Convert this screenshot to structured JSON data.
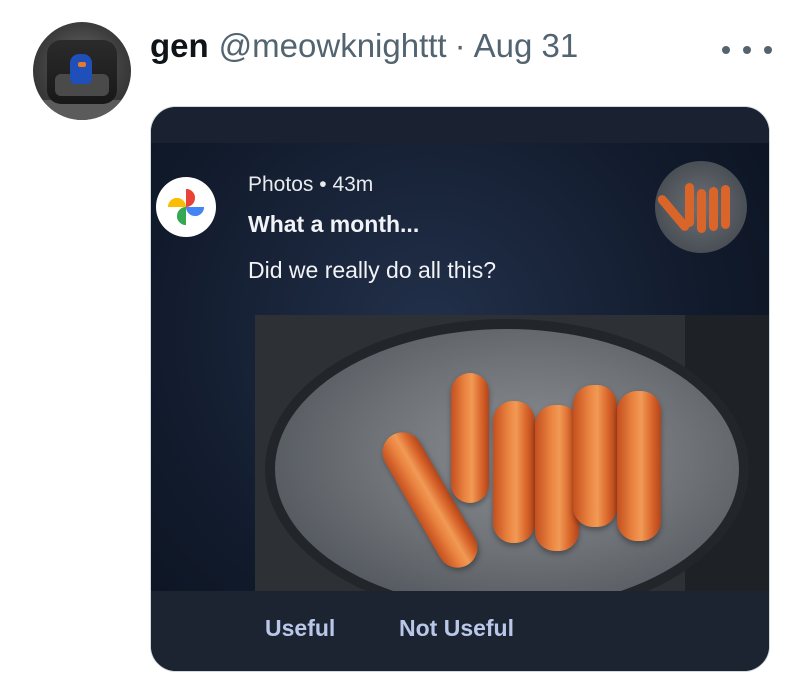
{
  "tweet": {
    "display_name": "gen",
    "handle": "@meowknighttt",
    "separator": "·",
    "date": "Aug 31",
    "more_icon": "ellipsis-horizontal-icon",
    "avatar_icon": "avatar-figure-in-chair"
  },
  "notification": {
    "app_icon": "google-photos-pinwheel-icon",
    "app_name": "Photos",
    "separator": "•",
    "time_ago": "43m",
    "title": "What a month...",
    "body": "Did we really do all this?",
    "actions": [
      "Useful",
      "Not Useful"
    ]
  },
  "colors": {
    "card_bg": "#111a2b",
    "action_text": "#b9c8e8",
    "handle_text": "#536471",
    "name_text": "#0f1419"
  }
}
